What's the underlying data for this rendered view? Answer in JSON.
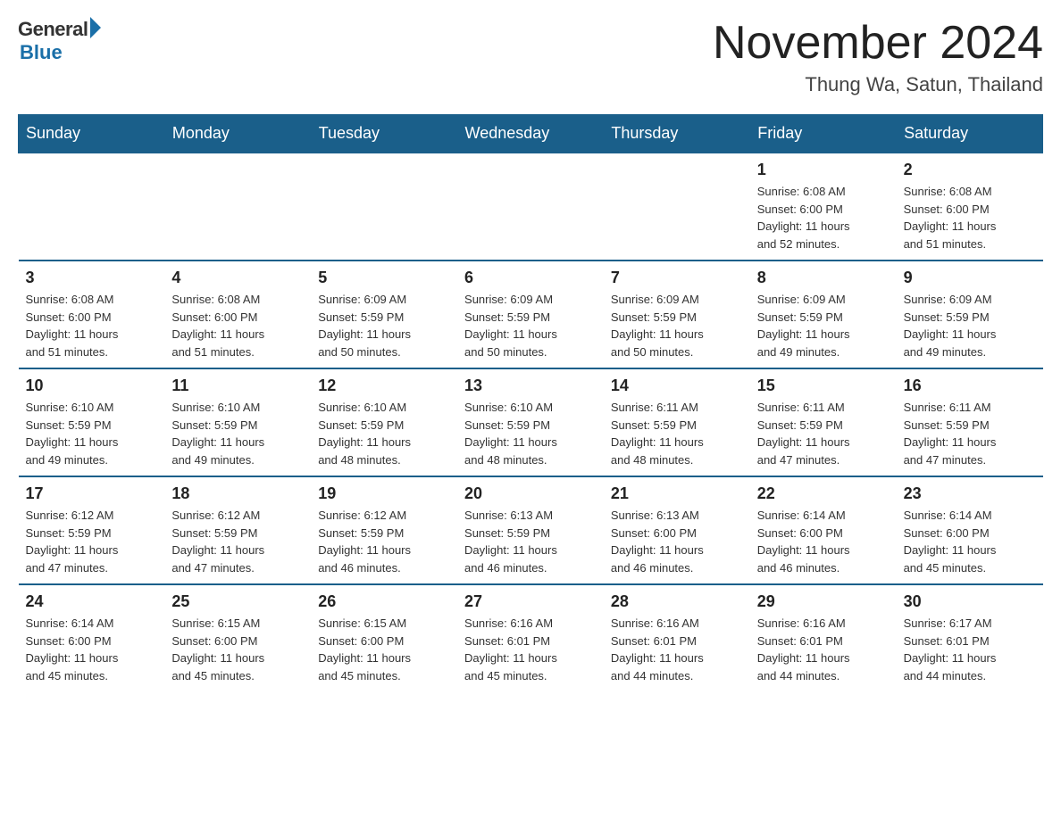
{
  "logo": {
    "general": "General",
    "blue": "Blue"
  },
  "header": {
    "title": "November 2024",
    "location": "Thung Wa, Satun, Thailand"
  },
  "weekdays": [
    "Sunday",
    "Monday",
    "Tuesday",
    "Wednesday",
    "Thursday",
    "Friday",
    "Saturday"
  ],
  "weeks": [
    [
      {
        "day": "",
        "info": ""
      },
      {
        "day": "",
        "info": ""
      },
      {
        "day": "",
        "info": ""
      },
      {
        "day": "",
        "info": ""
      },
      {
        "day": "",
        "info": ""
      },
      {
        "day": "1",
        "info": "Sunrise: 6:08 AM\nSunset: 6:00 PM\nDaylight: 11 hours\nand 52 minutes."
      },
      {
        "day": "2",
        "info": "Sunrise: 6:08 AM\nSunset: 6:00 PM\nDaylight: 11 hours\nand 51 minutes."
      }
    ],
    [
      {
        "day": "3",
        "info": "Sunrise: 6:08 AM\nSunset: 6:00 PM\nDaylight: 11 hours\nand 51 minutes."
      },
      {
        "day": "4",
        "info": "Sunrise: 6:08 AM\nSunset: 6:00 PM\nDaylight: 11 hours\nand 51 minutes."
      },
      {
        "day": "5",
        "info": "Sunrise: 6:09 AM\nSunset: 5:59 PM\nDaylight: 11 hours\nand 50 minutes."
      },
      {
        "day": "6",
        "info": "Sunrise: 6:09 AM\nSunset: 5:59 PM\nDaylight: 11 hours\nand 50 minutes."
      },
      {
        "day": "7",
        "info": "Sunrise: 6:09 AM\nSunset: 5:59 PM\nDaylight: 11 hours\nand 50 minutes."
      },
      {
        "day": "8",
        "info": "Sunrise: 6:09 AM\nSunset: 5:59 PM\nDaylight: 11 hours\nand 49 minutes."
      },
      {
        "day": "9",
        "info": "Sunrise: 6:09 AM\nSunset: 5:59 PM\nDaylight: 11 hours\nand 49 minutes."
      }
    ],
    [
      {
        "day": "10",
        "info": "Sunrise: 6:10 AM\nSunset: 5:59 PM\nDaylight: 11 hours\nand 49 minutes."
      },
      {
        "day": "11",
        "info": "Sunrise: 6:10 AM\nSunset: 5:59 PM\nDaylight: 11 hours\nand 49 minutes."
      },
      {
        "day": "12",
        "info": "Sunrise: 6:10 AM\nSunset: 5:59 PM\nDaylight: 11 hours\nand 48 minutes."
      },
      {
        "day": "13",
        "info": "Sunrise: 6:10 AM\nSunset: 5:59 PM\nDaylight: 11 hours\nand 48 minutes."
      },
      {
        "day": "14",
        "info": "Sunrise: 6:11 AM\nSunset: 5:59 PM\nDaylight: 11 hours\nand 48 minutes."
      },
      {
        "day": "15",
        "info": "Sunrise: 6:11 AM\nSunset: 5:59 PM\nDaylight: 11 hours\nand 47 minutes."
      },
      {
        "day": "16",
        "info": "Sunrise: 6:11 AM\nSunset: 5:59 PM\nDaylight: 11 hours\nand 47 minutes."
      }
    ],
    [
      {
        "day": "17",
        "info": "Sunrise: 6:12 AM\nSunset: 5:59 PM\nDaylight: 11 hours\nand 47 minutes."
      },
      {
        "day": "18",
        "info": "Sunrise: 6:12 AM\nSunset: 5:59 PM\nDaylight: 11 hours\nand 47 minutes."
      },
      {
        "day": "19",
        "info": "Sunrise: 6:12 AM\nSunset: 5:59 PM\nDaylight: 11 hours\nand 46 minutes."
      },
      {
        "day": "20",
        "info": "Sunrise: 6:13 AM\nSunset: 5:59 PM\nDaylight: 11 hours\nand 46 minutes."
      },
      {
        "day": "21",
        "info": "Sunrise: 6:13 AM\nSunset: 6:00 PM\nDaylight: 11 hours\nand 46 minutes."
      },
      {
        "day": "22",
        "info": "Sunrise: 6:14 AM\nSunset: 6:00 PM\nDaylight: 11 hours\nand 46 minutes."
      },
      {
        "day": "23",
        "info": "Sunrise: 6:14 AM\nSunset: 6:00 PM\nDaylight: 11 hours\nand 45 minutes."
      }
    ],
    [
      {
        "day": "24",
        "info": "Sunrise: 6:14 AM\nSunset: 6:00 PM\nDaylight: 11 hours\nand 45 minutes."
      },
      {
        "day": "25",
        "info": "Sunrise: 6:15 AM\nSunset: 6:00 PM\nDaylight: 11 hours\nand 45 minutes."
      },
      {
        "day": "26",
        "info": "Sunrise: 6:15 AM\nSunset: 6:00 PM\nDaylight: 11 hours\nand 45 minutes."
      },
      {
        "day": "27",
        "info": "Sunrise: 6:16 AM\nSunset: 6:01 PM\nDaylight: 11 hours\nand 45 minutes."
      },
      {
        "day": "28",
        "info": "Sunrise: 6:16 AM\nSunset: 6:01 PM\nDaylight: 11 hours\nand 44 minutes."
      },
      {
        "day": "29",
        "info": "Sunrise: 6:16 AM\nSunset: 6:01 PM\nDaylight: 11 hours\nand 44 minutes."
      },
      {
        "day": "30",
        "info": "Sunrise: 6:17 AM\nSunset: 6:01 PM\nDaylight: 11 hours\nand 44 minutes."
      }
    ]
  ]
}
